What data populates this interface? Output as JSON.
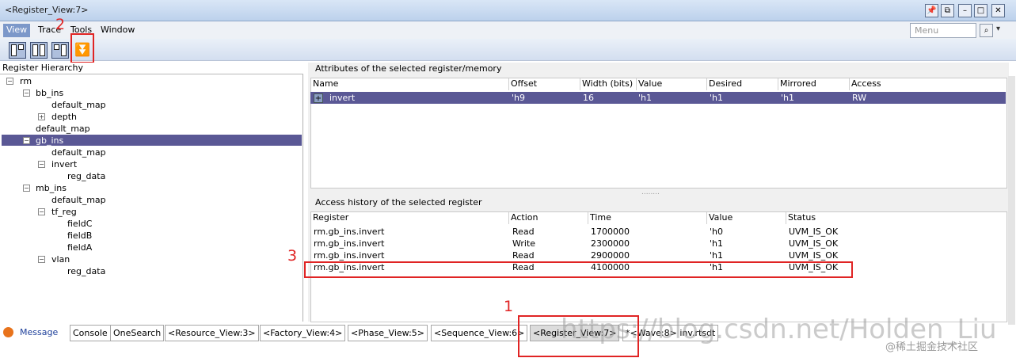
{
  "window": {
    "title": "<Register_View:7>"
  },
  "title_buttons": [
    "📌",
    "⧉",
    "–",
    "□",
    "✕"
  ],
  "menu": {
    "items": [
      "View",
      "Trace",
      "Tools",
      "Window"
    ],
    "search_placeholder": "Menu",
    "search_icon": "⌕",
    "dropdown": "▾"
  },
  "toolbar": {
    "filter_icon": "⏬"
  },
  "annotations": {
    "n1": "1",
    "n2": "2",
    "n3": "3"
  },
  "hierarchy": {
    "header": "Register Hierarchy",
    "nodes": [
      "rm",
      "bb_ins",
      "default_map",
      "depth",
      "default_map",
      "gb_ins",
      "default_map",
      "invert",
      "reg_data",
      "mb_ins",
      "default_map",
      "tf_reg",
      "fieldC",
      "fieldB",
      "fieldA",
      "vlan",
      "reg_data"
    ]
  },
  "attributes": {
    "title": "Attributes of the selected register/memory",
    "columns": [
      "Name",
      "Offset",
      "Width (bits)",
      "Value",
      "Desired",
      "Mirrored",
      "Access"
    ],
    "row": {
      "expander": "+",
      "name": "invert",
      "offset": "'h9",
      "width": "16",
      "value": "'h1",
      "desired": "'h1",
      "mirrored": "'h1",
      "access": "RW"
    },
    "splitter": "........"
  },
  "history": {
    "title": "Access history of the selected register",
    "columns": [
      "Register",
      "Action",
      "Time",
      "Value",
      "Status"
    ],
    "rows": [
      {
        "register": "rm.gb_ins.invert",
        "action": "Read",
        "time": "1700000",
        "value": "'h0",
        "status": "UVM_IS_OK"
      },
      {
        "register": "rm.gb_ins.invert",
        "action": "Write",
        "time": "2300000",
        "value": "'h1",
        "status": "UVM_IS_OK"
      },
      {
        "register": "rm.gb_ins.invert",
        "action": "Read",
        "time": "2900000",
        "value": "'h1",
        "status": "UVM_IS_OK"
      },
      {
        "register": "rm.gb_ins.invert",
        "action": "Read",
        "time": "4100000",
        "value": "'h1",
        "status": "UVM_IS_OK"
      }
    ]
  },
  "tabs": [
    "Message",
    "Console",
    "OneSearch",
    "<Resource_View:3>",
    "<Factory_View:4>",
    "<Phase_View:5>",
    "<Sequence_View:6>",
    "<Register_View:7>",
    "*<Wave:8> inv.rtsdt"
  ],
  "watermark": {
    "url": "https://blog.csdn.net/Holden_Liu",
    "site": "@稀土掘金技术社区"
  }
}
